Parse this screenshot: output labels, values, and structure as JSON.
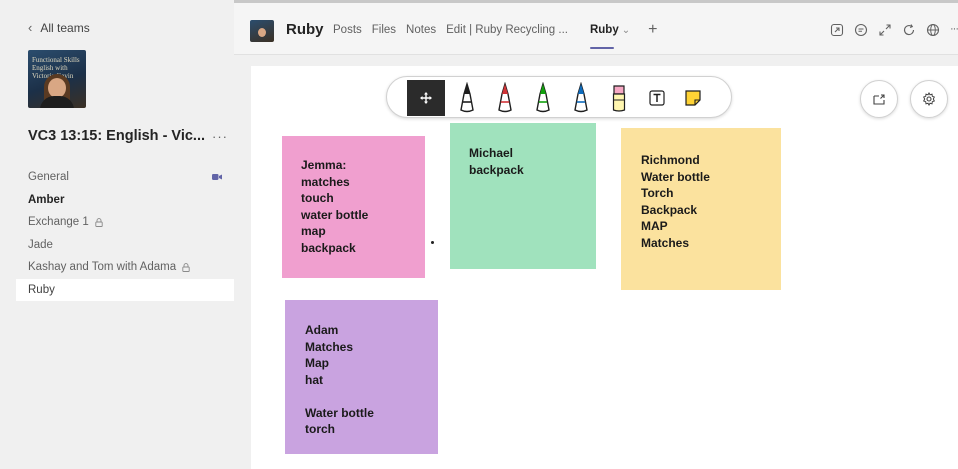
{
  "sidebar": {
    "back_label": "All teams",
    "avatar_text": "Functional Skills English with Victoria Gavin",
    "team_name": "VC3 13:15: English - Vic...",
    "more_label": "···",
    "channels": [
      {
        "label": "General"
      },
      {
        "label": "Amber"
      },
      {
        "label": "Exchange 1"
      },
      {
        "label": "Jade"
      },
      {
        "label": "Kashay and Tom with Adama"
      },
      {
        "label": "Ruby"
      }
    ]
  },
  "header": {
    "title": "Ruby",
    "tabs": [
      {
        "label": "Posts"
      },
      {
        "label": "Files"
      },
      {
        "label": "Notes"
      },
      {
        "label": "Edit | Ruby Recycling ..."
      },
      {
        "label": "Ruby"
      }
    ],
    "add_tab": "+",
    "icons": [
      "popout-icon",
      "chat-icon",
      "expand-icon",
      "refresh-icon",
      "globe-icon",
      "more-icon"
    ],
    "more_label": "···"
  },
  "toolbar": {
    "tools": [
      "move-tool-icon",
      "black-pen-icon",
      "red-pen-icon",
      "green-pen-icon",
      "blue-pen-icon",
      "highlighter-icon",
      "text-tool-icon",
      "sticky-note-icon"
    ],
    "colors": {
      "black": "#1f1f1f",
      "red": "#d13438",
      "green": "#13a10e",
      "blue": "#0f6cbd",
      "highlighter": "#f7a8c4"
    }
  },
  "notes": [
    {
      "text": "Jemma:\nmatches\ntouch\nwater bottle\nmap\nbackpack",
      "color": "#f09fcf"
    },
    {
      "text": "Michael\nbackpack",
      "color": "#a0e2bd"
    },
    {
      "text": "Richmond\nWater bottle\nTorch\nBackpack\nMAP\nMatches",
      "color": "#fbe29e"
    },
    {
      "text": "Adam\nMatches\nMap\nhat\n\nWater bottle\ntorch",
      "color": "#c9a3e0"
    }
  ],
  "colors": {
    "accent": "#6264a7"
  }
}
